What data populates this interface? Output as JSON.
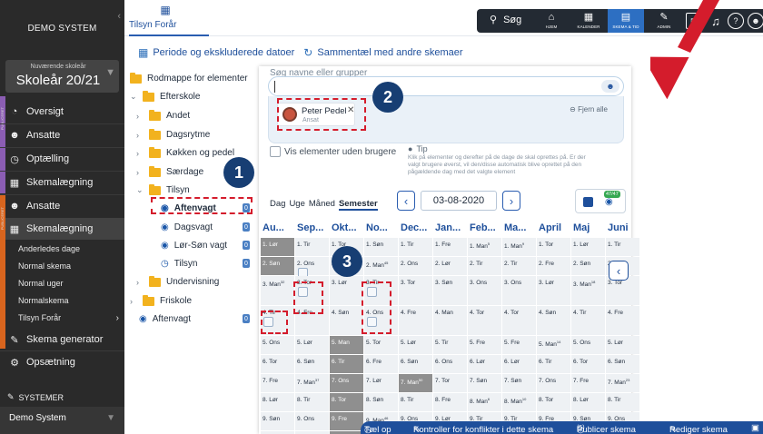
{
  "nav": {
    "org": "DEMO SYSTEM",
    "school_year_label": "Nuværende skoleår",
    "school_year": "Skoleår 20/21",
    "public_label_1": "PUBLICERET",
    "public_label_2": "PUBLICERET",
    "items": [
      {
        "label": "Oversigt",
        "icon": "dashboard-icon"
      },
      {
        "label": "Ansatte",
        "icon": "users-icon"
      },
      {
        "label": "Optælling",
        "icon": "clock-icon"
      },
      {
        "label": "Skemalægning",
        "icon": "calendar-icon"
      },
      {
        "label": "Ansatte",
        "icon": "users-icon"
      },
      {
        "label": "Skemalægning",
        "icon": "calendar-icon"
      }
    ],
    "subitems": [
      "Anderledes dage",
      "Normal skema",
      "Normal uger",
      "Normalskema",
      "Tilsyn Forår"
    ],
    "generator": "Skema generator",
    "settings": "Opsætning",
    "systems_label": "SYSTEMER",
    "system_name": "Demo System"
  },
  "tab": {
    "label": "Tilsyn Forår"
  },
  "topbar": {
    "search": "Søg",
    "buttons": [
      {
        "label": "HJEM",
        "icon": "home-icon"
      },
      {
        "label": "KALENDER",
        "icon": "calendar-icon"
      },
      {
        "label": "SKEMA & TID",
        "icon": "schedule-icon"
      },
      {
        "label": "ADMIN",
        "icon": "wrench-icon"
      }
    ]
  },
  "toolbar": {
    "period": "Periode og ekskluderede datoer",
    "combine": "Sammentæl med andre skemaer"
  },
  "tree": {
    "root": "Rodmappe for elementer",
    "efterskole": "Efterskole",
    "andet": "Andet",
    "dagsrytme": "Dagsrytme",
    "kokken": "Køkken og pedel",
    "saerdage": "Særdage",
    "tilsyn": "Tilsyn",
    "aftenvagt": "Aftenvagt",
    "dagsvagt": "Dagsvagt",
    "lorson": "Lør-Søn vagt",
    "tilsyn2": "Tilsyn",
    "undervisning": "Undervisning",
    "friskole": "Friskole",
    "aftenvagt2": "Aftenvagt",
    "counts": [
      "0",
      "0",
      "0",
      "0",
      "0"
    ]
  },
  "callouts": [
    "1",
    "2",
    "3"
  ],
  "panel": {
    "search_label": "Søg navne eller grupper",
    "chip_name": "Peter Pedel",
    "chip_role": "Ansat",
    "remove_all": "Fjern alle",
    "no_users": "Vis elementer uden brugere",
    "tip_title": "Tip",
    "tip_body": "Klik på elementer og derefter på de dage de skal oprettes på. Er der valgt brugere øverst, vil den/disse automatisk blive oprettet på den pågældende dag med det valgte element",
    "views": [
      "Dag",
      "Uge",
      "Måned",
      "Semester"
    ],
    "date": "03-08-2020",
    "legend_count": "47/47"
  },
  "calendar": {
    "months": [
      "Au...",
      "Sep...",
      "Okt...",
      "No...",
      "Dec...",
      "Jan...",
      "Feb...",
      "Ma...",
      "April",
      "Maj",
      "Juni"
    ],
    "rows": [
      [
        "1. Lør",
        "1. Tir",
        "1. Tor",
        "1. Søn",
        "1. Tir",
        "1. Fre",
        "1. Man",
        "1. Man",
        "1. Tor",
        "1. Lør",
        "1. Tir"
      ],
      [
        "2. Søn",
        "2. Ons",
        "2. Fre",
        "2. Man",
        "2. Ons",
        "2. Lør",
        "2. Tir",
        "2. Tir",
        "2. Fre",
        "2. Søn",
        "2. Ons"
      ],
      [
        "3. Man",
        "3. Tor",
        "3. Lør",
        "3. Tir",
        "3. Tor",
        "3. Søn",
        "3. Ons",
        "3. Ons",
        "3. Lør",
        "3. Man",
        "3. Tor"
      ],
      [
        "4. Tir",
        "4. Fre",
        "4. Søn",
        "4. Ons",
        "4. Fre",
        "4. Man",
        "4. Tor",
        "4. Tor",
        "4. Søn",
        "4. Tir",
        "4. Fre"
      ],
      [
        "5. Ons",
        "5. Lør",
        "5. Man",
        "5. Tor",
        "5. Lør",
        "5. Tir",
        "5. Fre",
        "5. Fre",
        "5. Man",
        "5. Ons",
        "5. Lør"
      ],
      [
        "6. Tor",
        "6. Søn",
        "6. Tir",
        "6. Fre",
        "6. Søn",
        "6. Ons",
        "6. Lør",
        "6. Lør",
        "6. Tir",
        "6. Tor",
        "6. Søn"
      ],
      [
        "7. Fre",
        "7. Man",
        "7. Ons",
        "7. Lør",
        "7. Man",
        "7. Tor",
        "7. Søn",
        "7. Søn",
        "7. Ons",
        "7. Fre",
        "7. Man"
      ],
      [
        "8. Lør",
        "8. Tir",
        "8. Tor",
        "8. Søn",
        "8. Tir",
        "8. Fre",
        "8. Man",
        "8. Man",
        "8. Tor",
        "8. Lør",
        "8. Tir"
      ],
      [
        "9. Søn",
        "9. Ons",
        "9. Fre",
        "9. Man",
        "9. Ons",
        "9. Lør",
        "9. Tir",
        "9. Tir",
        "9. Fre",
        "9. Søn",
        "9. Ons"
      ],
      [
        "10. Man",
        "10. Tor",
        "10. Lør",
        "",
        "",
        "",
        "",
        "",
        "",
        "",
        ""
      ]
    ],
    "weeks": {
      "0.6": "5",
      "0.7": "9",
      "1.3": "45",
      "2.0": "32",
      "2.9": "18",
      "4.8": "14",
      "6.1": "37",
      "6.4": "50",
      "6.10": "23",
      "7.6": "6",
      "7.7": "10",
      "8.3": "46",
      "9.0": "33"
    },
    "gray": [
      "0.0",
      "1.0",
      "4.2",
      "5.2",
      "6.2",
      "7.2",
      "8.2",
      "9.2",
      "6.4"
    ]
  },
  "footer": {
    "count": "Tæl op",
    "conflicts": "Kontroller for konflikter i dette skema",
    "publish": "Publicer skema",
    "publish_count": "(5)",
    "edit": "Rediger skema"
  }
}
